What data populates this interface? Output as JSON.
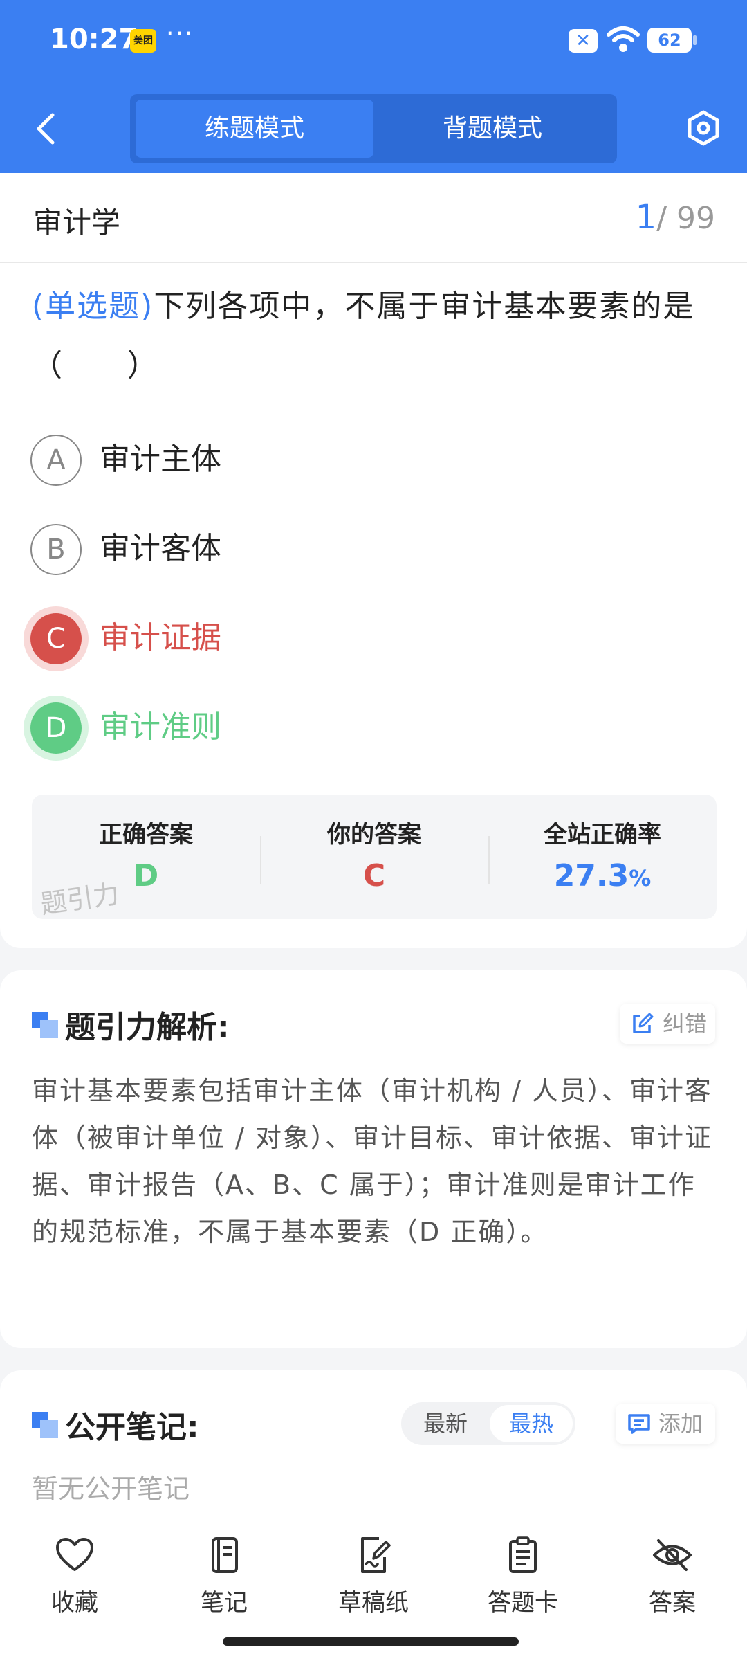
{
  "status_bar": {
    "time": "10:27",
    "app_badge": "美团",
    "dots": "···",
    "battery": "62"
  },
  "header": {
    "mode_tabs": [
      "练题模式",
      "背题模式"
    ],
    "active_mode": 0
  },
  "question_meta": {
    "subject": "审计学",
    "current": "1",
    "total": "/ 99"
  },
  "question": {
    "type": "(单选题)",
    "text": "下列各项中，不属于审计基本要素的是（　　）",
    "options": [
      {
        "letter": "A",
        "text": "审计主体",
        "state": "normal"
      },
      {
        "letter": "B",
        "text": "审计客体",
        "state": "normal"
      },
      {
        "letter": "C",
        "text": "审计证据",
        "state": "wrong"
      },
      {
        "letter": "D",
        "text": "审计准则",
        "state": "correct"
      }
    ]
  },
  "result": {
    "correct_label": "正确答案",
    "correct_value": "D",
    "yours_label": "你的答案",
    "yours_value": "C",
    "rate_label": "全站正确率",
    "rate_value": "27.3",
    "rate_unit": "%",
    "watermark": "题引力"
  },
  "analysis": {
    "title": "题引力解析:",
    "report_btn": "纠错",
    "text": "审计基本要素包括审计主体（审计机构 / 人员）、审计客体（被审计单位 / 对象）、审计目标、审计依据、审计证据、审计报告（A、B、C 属于）；审计准则是审计工作的规范标准，不属于基本要素（D 正确）。"
  },
  "notes": {
    "title": "公开笔记:",
    "sort_new": "最新",
    "sort_hot": "最热",
    "sort_active": "最热",
    "add_btn": "添加",
    "empty_text": "暂无公开笔记"
  },
  "bottom_nav": [
    "收藏",
    "笔记",
    "草稿纸",
    "答题卡",
    "答案"
  ],
  "colors": {
    "primary": "#3b7ff2",
    "wrong": "#d6504b",
    "correct": "#5fcc85"
  }
}
